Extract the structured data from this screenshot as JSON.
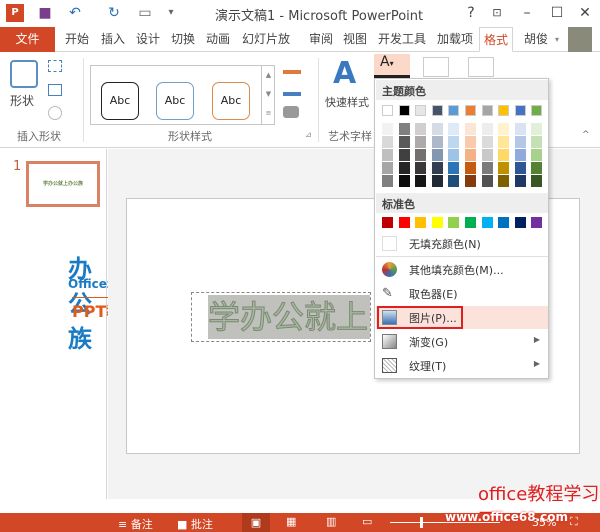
{
  "window": {
    "title": "演示文稿1 - Microsoft PowerPoint",
    "help": "?"
  },
  "tabs": [
    {
      "label": "文件"
    },
    {
      "label": "开始"
    },
    {
      "label": "插入"
    },
    {
      "label": "设计"
    },
    {
      "label": "切换"
    },
    {
      "label": "动画"
    },
    {
      "label": "幻灯片放"
    },
    {
      "label": "审阅"
    },
    {
      "label": "视图"
    },
    {
      "label": "开发工具"
    },
    {
      "label": "加载项"
    },
    {
      "label": "格式"
    }
  ],
  "user": {
    "name": "胡俊"
  },
  "ribbon": {
    "shape_label": "形状",
    "group_insert_shapes": "插入形状",
    "group_shape_styles": "形状样式",
    "quick_styles": "快速样式",
    "group_wordart": "艺术字样",
    "style_sample": "Abc"
  },
  "slide_panel": {
    "number": "1",
    "thumb_text": "学办公就上办公族"
  },
  "slide": {
    "text": "学办公就上"
  },
  "logo": {
    "line1": "办公族",
    "line2": "Officezu.com",
    "line3": "PPT教程"
  },
  "menu": {
    "theme_header": "主题颜色",
    "theme_colors": [
      "#ffffff",
      "#000000",
      "#e7e6e6",
      "#44546a",
      "#5b9bd5",
      "#ed7d31",
      "#a5a5a5",
      "#ffc000",
      "#4472c4",
      "#70ad47"
    ],
    "theme_shades": [
      [
        "#f2f2f2",
        "#d9d9d9",
        "#bfbfbf",
        "#a6a6a6",
        "#808080"
      ],
      [
        "#808080",
        "#595959",
        "#404040",
        "#262626",
        "#0d0d0d"
      ],
      [
        "#d0cece",
        "#aeaaaa",
        "#757070",
        "#3a3838",
        "#171616"
      ],
      [
        "#d6dce5",
        "#adb9ca",
        "#8497b0",
        "#333f50",
        "#222a35"
      ],
      [
        "#deebf7",
        "#bdd7ee",
        "#9dc3e6",
        "#2e75b6",
        "#1f4e79"
      ],
      [
        "#fbe5d6",
        "#f8cbad",
        "#f4b183",
        "#c55a11",
        "#843c0c"
      ],
      [
        "#ededed",
        "#dbdbdb",
        "#c9c9c9",
        "#7b7b7b",
        "#525252"
      ],
      [
        "#fff2cc",
        "#ffe699",
        "#ffd966",
        "#bf9000",
        "#7f6000"
      ],
      [
        "#dae3f3",
        "#b4c7e7",
        "#8faadc",
        "#2f5597",
        "#203864"
      ],
      [
        "#e2f0d9",
        "#c5e0b4",
        "#a9d18e",
        "#548235",
        "#385723"
      ]
    ],
    "standard_header": "标准色",
    "standard_colors": [
      "#c00000",
      "#ff0000",
      "#ffc000",
      "#ffff00",
      "#92d050",
      "#00b050",
      "#00b0f0",
      "#0070c0",
      "#002060",
      "#7030a0"
    ],
    "items": [
      {
        "label": "无填充颜色(N)"
      },
      {
        "label": "其他填充颜色(M)..."
      },
      {
        "label": "取色器(E)"
      },
      {
        "label": "图片(P)..."
      },
      {
        "label": "渐变(G)"
      },
      {
        "label": "纹理(T)"
      }
    ]
  },
  "status": {
    "notes": "备注",
    "comments": "批注",
    "zoom": "35%"
  },
  "watermark": {
    "line1": "office教程学习网",
    "line2": "www.office68.com"
  },
  "colors": {
    "accent": "#d24726",
    "highlight": "#fbe3dc",
    "picture_box": "#e02020"
  }
}
